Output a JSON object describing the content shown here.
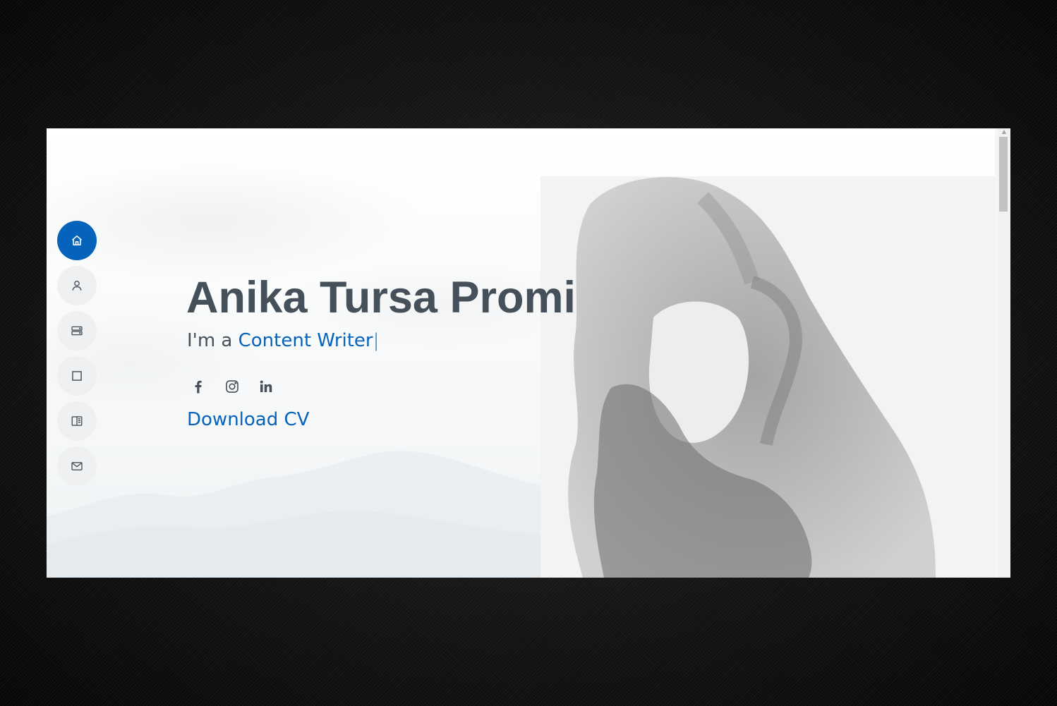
{
  "hero": {
    "name": "Anika Tursa Promi",
    "intro": "I'm a ",
    "typed_role": "Content Writer",
    "cursor": "|",
    "download_cv": "Download CV"
  },
  "nav": {
    "items": [
      {
        "icon": "house-icon",
        "active": true
      },
      {
        "icon": "person-icon",
        "active": false
      },
      {
        "icon": "server-icon",
        "active": false
      },
      {
        "icon": "square-icon",
        "active": false
      },
      {
        "icon": "book-icon",
        "active": false
      },
      {
        "icon": "envelope-icon",
        "active": false
      }
    ]
  },
  "social": {
    "items": [
      {
        "icon": "facebook-icon"
      },
      {
        "icon": "instagram-icon"
      },
      {
        "icon": "linkedin-icon"
      }
    ]
  },
  "colors": {
    "accent": "#0563bb",
    "text": "#45505b",
    "nav_inactive": "#eef0f2"
  }
}
